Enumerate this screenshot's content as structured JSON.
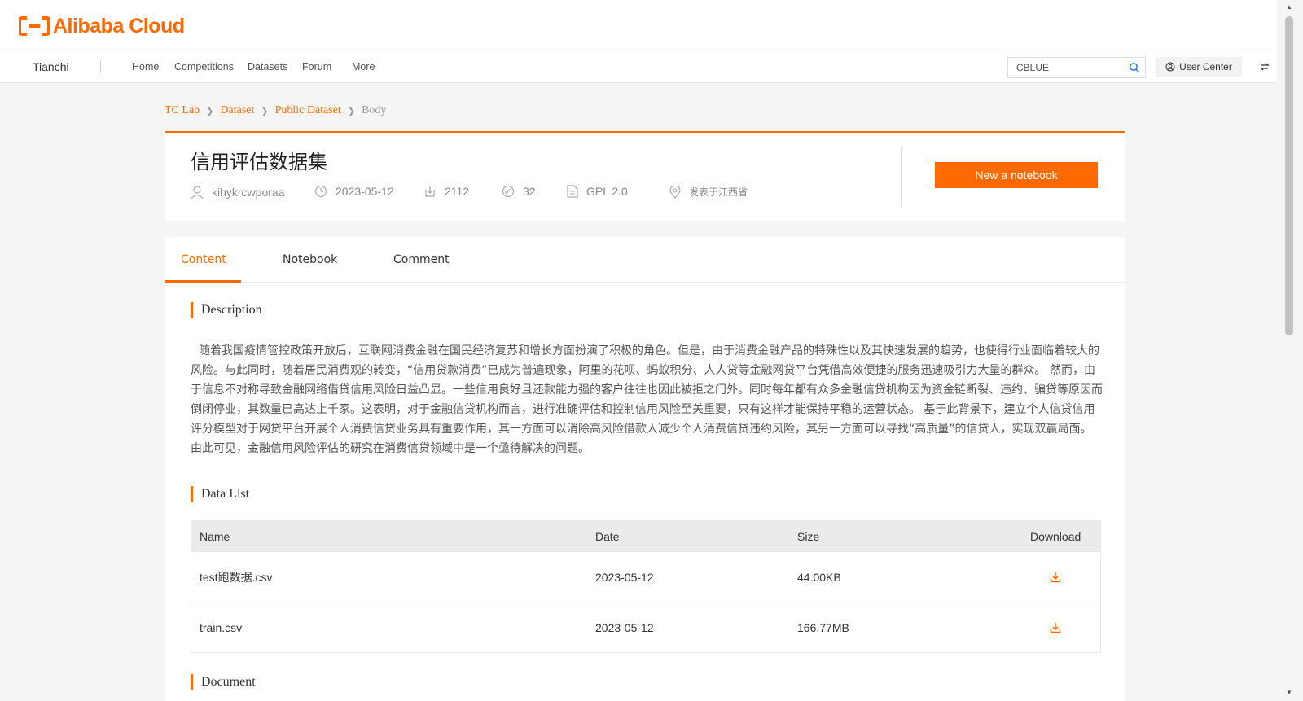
{
  "header": {
    "logo_text": "Alibaba Cloud"
  },
  "nav": {
    "brand": "Tianchi",
    "items": [
      "Home",
      "Competitions",
      "Datasets",
      "Forum",
      "More"
    ],
    "search_value": "CBLUE",
    "user_center": "User Center"
  },
  "breadcrumb": [
    "TC Lab",
    "Dataset",
    "Public Dataset",
    "Body"
  ],
  "dataset": {
    "title": "信用评估数据集",
    "author": "kihykrcwporaa",
    "date": "2023-05-12",
    "downloads": "2112",
    "views": "32",
    "license": "GPL 2.0",
    "location": "发表于江西省",
    "new_notebook": "New a notebook"
  },
  "tabs": [
    "Content",
    "Notebook",
    "Comment"
  ],
  "sections": {
    "description_title": "Description",
    "description": "随着我国疫情管控政策开放后，互联网消费金融在国民经济复苏和增长方面扮演了积极的角色。但是，由于消费金融产品的特殊性以及其快速发展的趋势，也使得行业面临着较大的风险。与此同时，随着居民消费观的转变，“信用贷款消费”已成为普遍现象，阿里的花呗、蚂蚁积分、人人贷等金融网贷平台凭借高效便捷的服务迅速吸引力大量的群众。 然而，由于信息不对称导致金融网络借贷信用风险日益凸显。一些信用良好且还款能力强的客户往往也因此被拒之门外。同时每年都有众多金融信贷机构因为资金链断裂、违约、骗贷等原因而倒闭停业，其数量已高达上千家。这表明，对于金融信贷机构而言，进行准确评估和控制信用风险至关重要，只有这样才能保持平稳的运营状态。 基于此背景下，建立个人信贷信用评分模型对于网贷平台开展个人消费信贷业务具有重要作用，其一方面可以消除高风险借款人减少个人消费信贷违约风险，其另一方面可以寻找“高质量”的信贷人，实现双赢局面。由此可见，金融信用风险评估的研究在消费信贷领域中是一个亟待解决的问题。",
    "datalist_title": "Data List",
    "document_title": "Document"
  },
  "table": {
    "headers": [
      "Name",
      "Date",
      "Size",
      "Download"
    ],
    "rows": [
      {
        "name": "test跑数据.csv",
        "date": "2023-05-12",
        "size": "44.00KB"
      },
      {
        "name": "train.csv",
        "date": "2023-05-12",
        "size": "166.77MB"
      }
    ]
  },
  "colors": {
    "accent": "#ff6a00"
  }
}
